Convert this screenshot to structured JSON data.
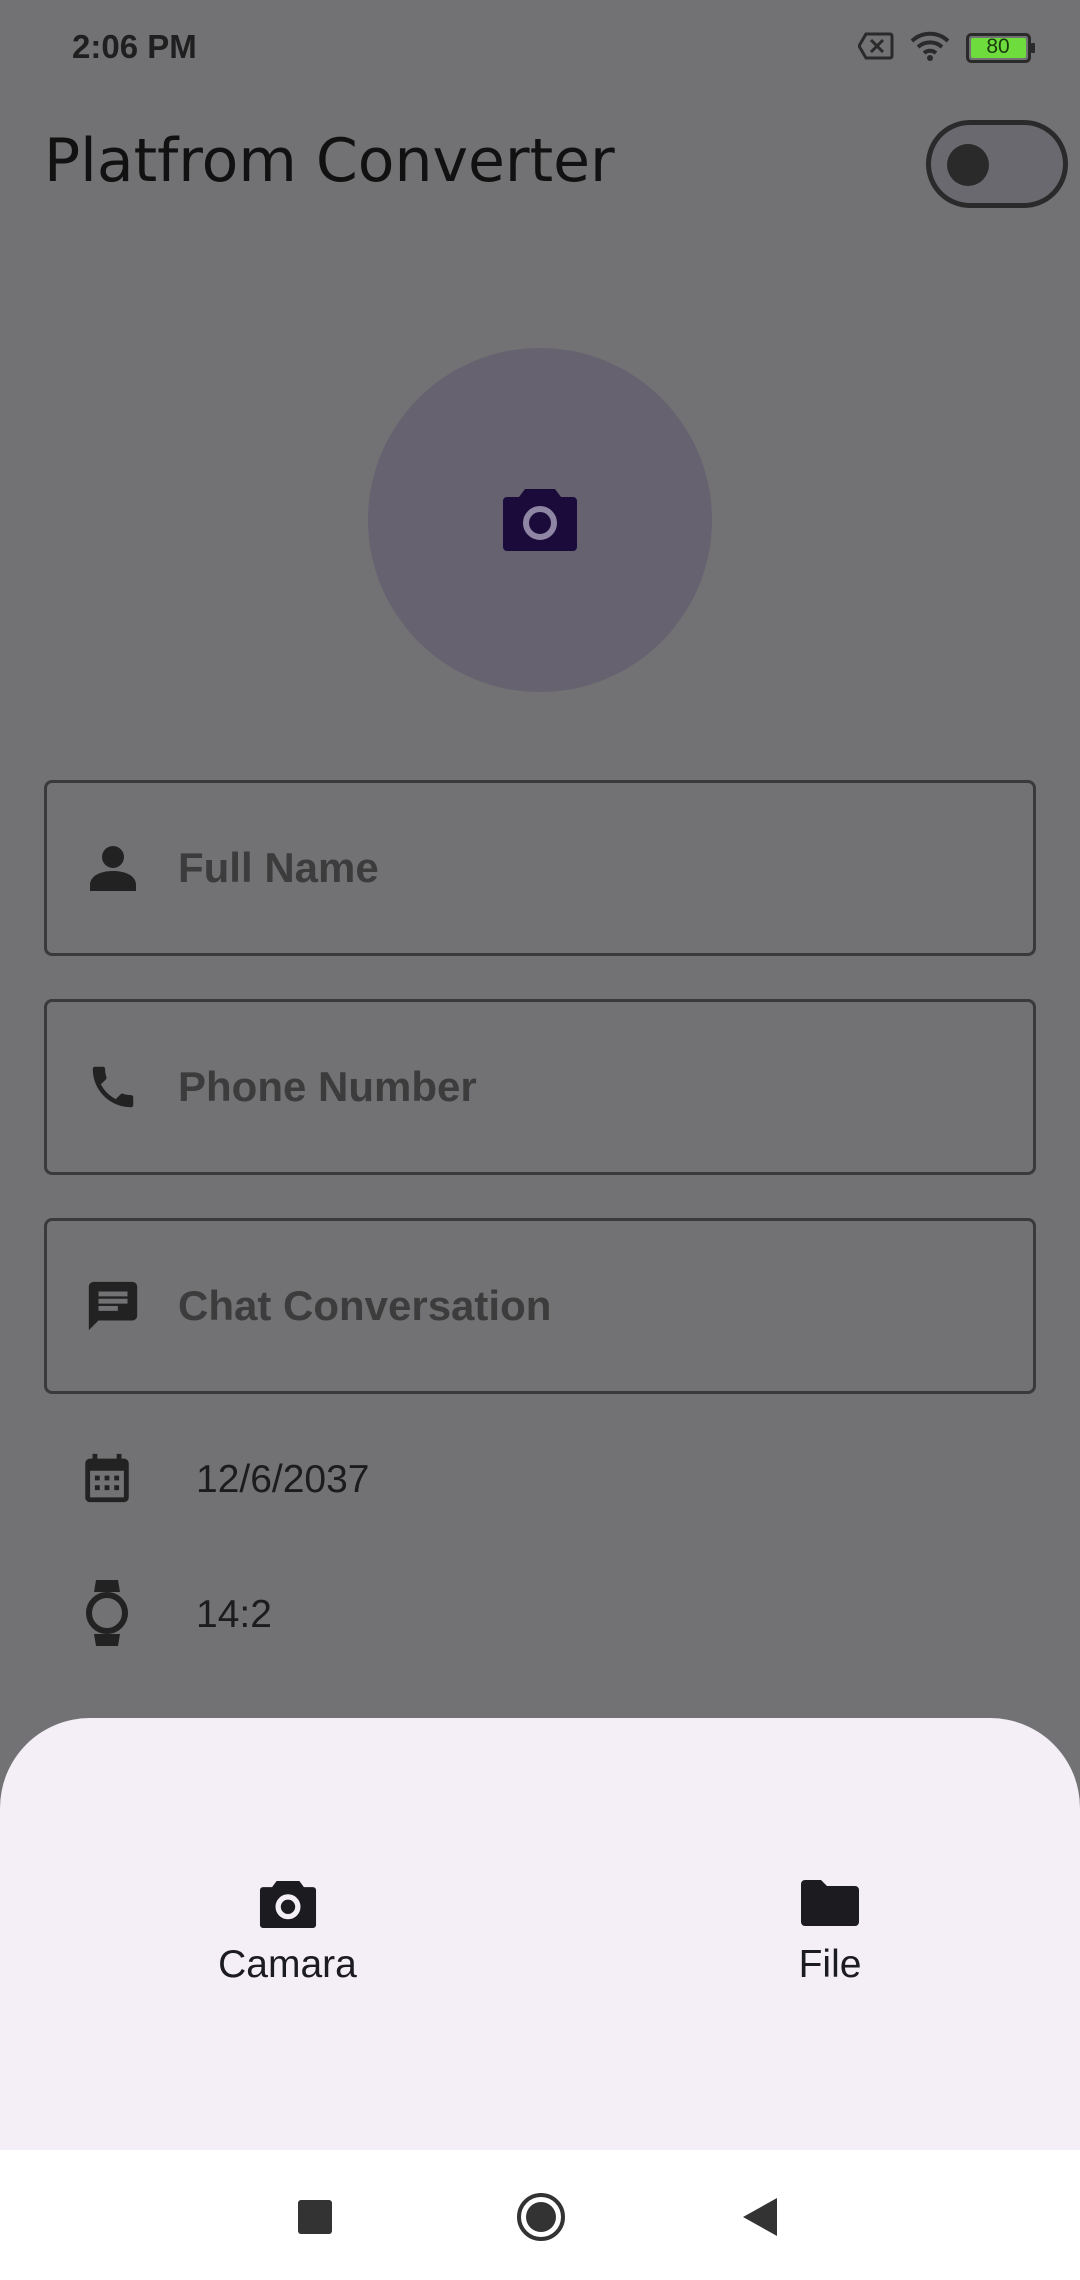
{
  "status_bar": {
    "time": "2:06 PM",
    "battery": "80"
  },
  "app_bar": {
    "title": "Platfrom Converter"
  },
  "form": {
    "full_name_placeholder": "Full Name",
    "phone_placeholder": "Phone Number",
    "chat_placeholder": "Chat Conversation",
    "date_value": "12/6/2037",
    "time_value": "14:2"
  },
  "bottom_sheet": {
    "camera_label": "Camara",
    "file_label": "File"
  },
  "colors": {
    "scrim_background": "#727174",
    "sheet_background": "#f4eff6",
    "camera_icon_accent": "#1b0b3b",
    "battery_green": "#6edc3c"
  }
}
